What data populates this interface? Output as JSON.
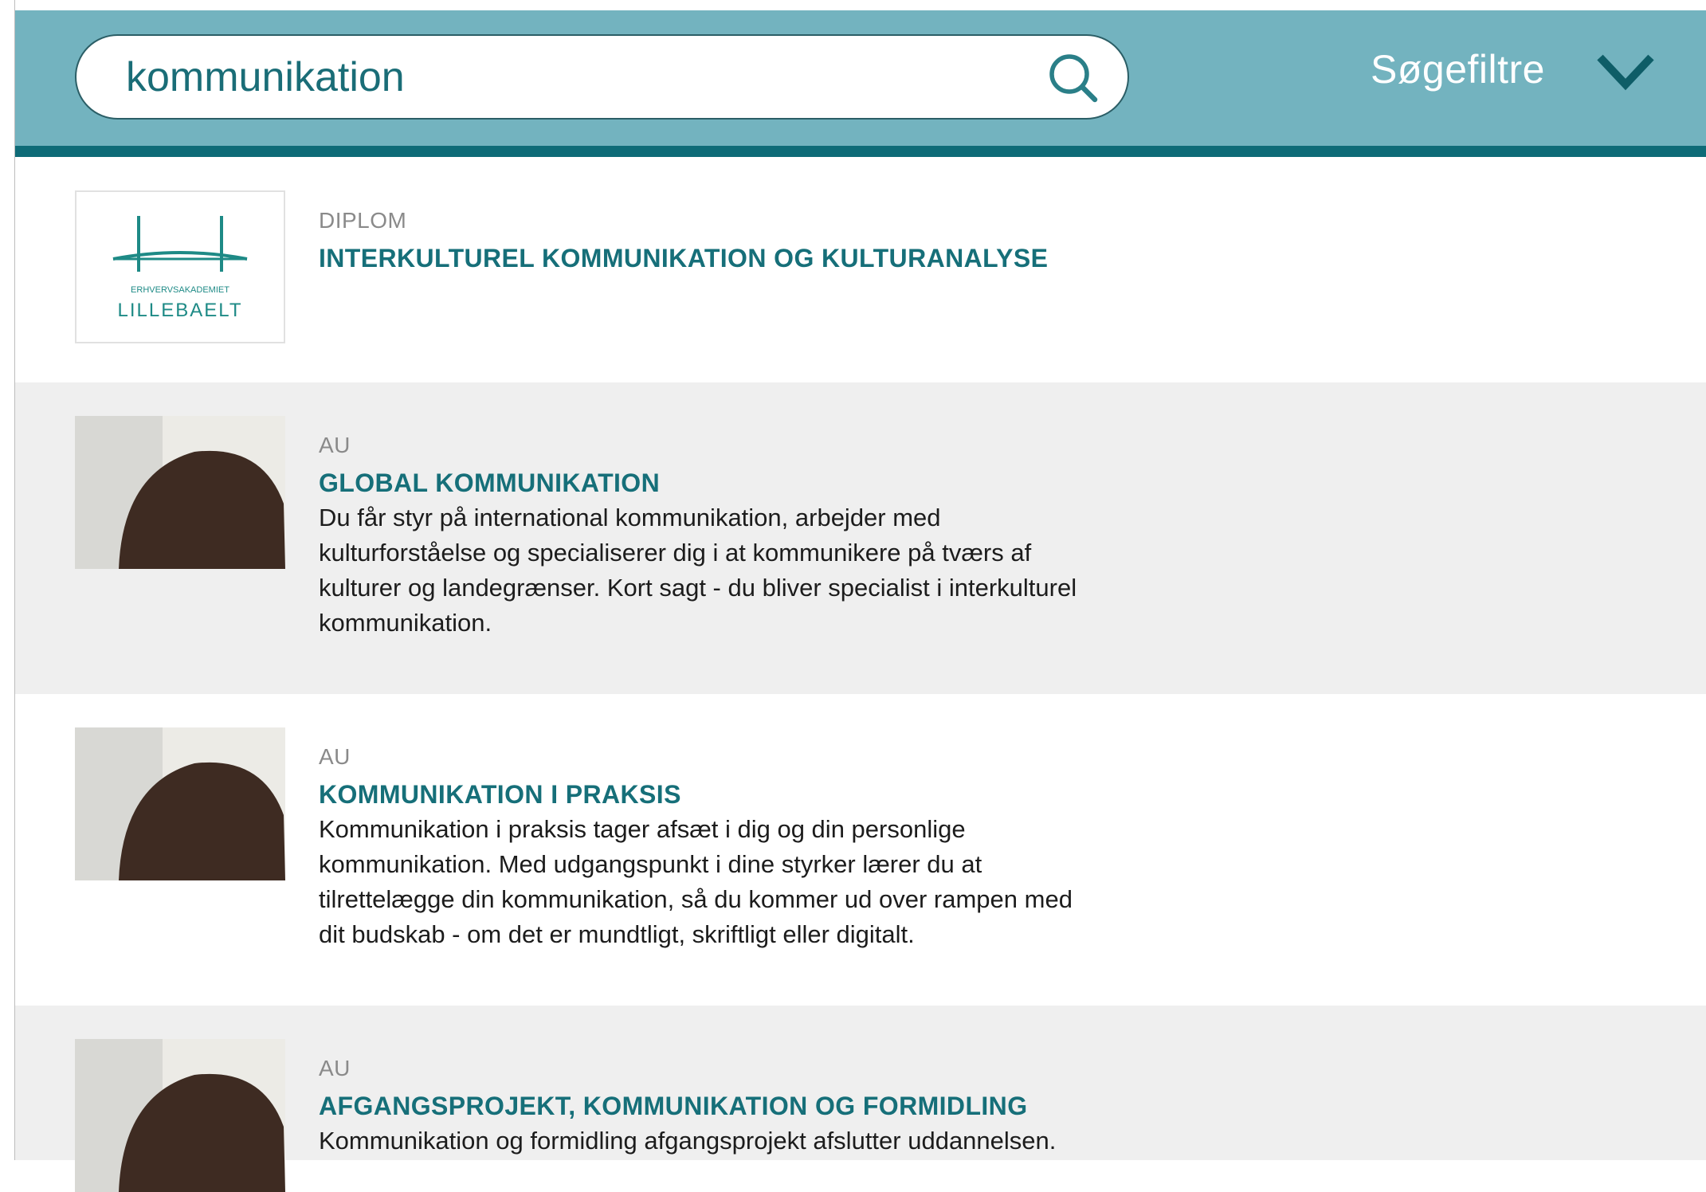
{
  "search": {
    "value": "kommunikation",
    "icon": "search-icon"
  },
  "filters": {
    "label": "Søgefiltre",
    "icon": "chevron-down-icon"
  },
  "colors": {
    "header_bg": "#73b3bf",
    "header_rule": "#0e6b77",
    "title": "#166f79",
    "gray_row": "#efefef"
  },
  "results": [
    {
      "category": "DIPLOM",
      "title": "INTERKULTUREL KOMMUNIKATION OG KULTURANALYSE",
      "logo": {
        "small_text": "ERHVERVSAKADEMIET",
        "big_text": "LILLEBAELT"
      }
    },
    {
      "category": "AU",
      "title": "GLOBAL KOMMUNIKATION",
      "description": "Du får styr på international kommunikation, arbejder med kulturforståelse og specialiserer dig i at kommunikere på tværs af kulturer og landegrænser. Kort sagt - du bliver specialist i interkulturel kommunikation."
    },
    {
      "category": "AU",
      "title": "KOMMUNIKATION I PRAKSIS",
      "description": "Kommunikation i praksis tager afsæt i dig og din personlige kommunikation. Med udgangspunkt i dine styrker lærer du at tilrettelægge din kommunikation, så du kommer ud over rampen med dit budskab - om det er mundtligt, skriftligt eller digitalt."
    },
    {
      "category": "AU",
      "title": "AFGANGSPROJEKT, KOMMUNIKATION OG FORMIDLING",
      "description": "Kommunikation og formidling afgangsprojekt afslutter uddannelsen."
    }
  ]
}
